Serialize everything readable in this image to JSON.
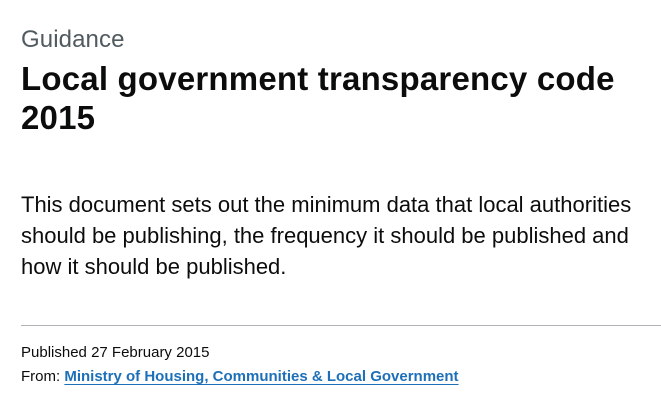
{
  "header": {
    "caption": "Guidance",
    "title": "Local government transparency code 2015"
  },
  "main": {
    "summary": "This document sets out the minimum data that local authorities should be publishing, the frequency it should be published and how it should be published."
  },
  "metadata": {
    "published_label": "Published",
    "published_date": "27 February 2015",
    "from_label": "From:",
    "organisation": "Ministry of Housing, Communities & Local Government"
  },
  "colors": {
    "text": "#0b0c0c",
    "secondary_text": "#505a5f",
    "link": "#1d70b8",
    "divider": "#b1b4b6"
  }
}
